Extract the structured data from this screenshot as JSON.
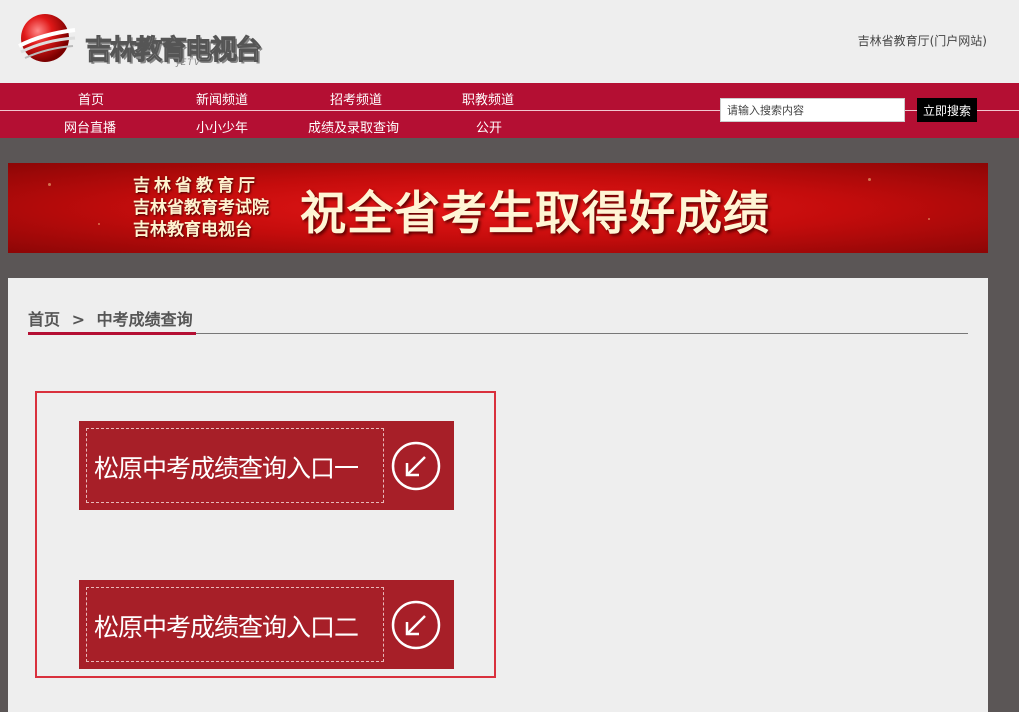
{
  "header": {
    "logo_text": "吉林教育电视台",
    "logo_sub": "JETV",
    "portal_link": "吉林省教育厅(门户网站)"
  },
  "nav": {
    "row1": [
      "首页",
      "新闻频道",
      "招考频道",
      "职教频道"
    ],
    "row2": [
      "网台直播",
      "小小少年",
      "成绩及录取查询",
      "公开"
    ],
    "search_placeholder": "请输入搜索内容",
    "search_button": "立即搜索"
  },
  "banner": {
    "line1": "吉林省教育厅",
    "line2": "吉林省教育考试院",
    "line3": "吉林教育电视台",
    "main": "祝全省考生取得好成绩"
  },
  "breadcrumb": {
    "home": "首页",
    "separator": ">",
    "current": "中考成绩查询"
  },
  "entries": [
    {
      "label": "松原中考成绩查询入口一",
      "icon": "arrow-down-left-circle-icon"
    },
    {
      "label": "松原中考成绩查询入口二",
      "icon": "arrow-down-left-circle-icon"
    }
  ],
  "colors": {
    "nav_bg": "#b40f33",
    "entry_bg": "#a71f28",
    "entry_border": "#d9303d",
    "frame_bg": "#5b5656"
  }
}
